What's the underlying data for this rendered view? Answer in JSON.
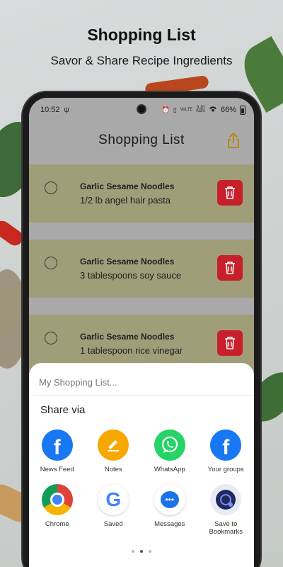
{
  "promo": {
    "title": "Shopping List",
    "subtitle": "Savor & Share Recipe Ingredients"
  },
  "status_bar": {
    "time": "10:52",
    "usb_icon": "usb-icon",
    "battery": "66%",
    "data_rate_top": "0.10",
    "data_rate_bottom": "KB/s",
    "signal_label": "VoLTE"
  },
  "app": {
    "title": "Shopping List",
    "share_icon": "share-icon"
  },
  "items": [
    {
      "recipe": "Garlic Sesame Noodles",
      "ingredient": "1/2 lb angel hair pasta"
    },
    {
      "recipe": "Garlic Sesame Noodles",
      "ingredient": "3 tablespoons soy sauce"
    },
    {
      "recipe": "Garlic Sesame Noodles",
      "ingredient": "1 tablespoon rice vinegar"
    }
  ],
  "share_sheet": {
    "subject": "My Shopping List...",
    "heading": "Share via",
    "apps": [
      {
        "label": "News Feed",
        "icon": "facebook-icon"
      },
      {
        "label": "Notes",
        "icon": "notes-icon"
      },
      {
        "label": "WhatsApp",
        "icon": "whatsapp-icon"
      },
      {
        "label": "Your groups",
        "icon": "facebook-icon"
      },
      {
        "label": "Chrome",
        "icon": "chrome-icon"
      },
      {
        "label": "Saved",
        "icon": "google-icon"
      },
      {
        "label": "Messages",
        "icon": "messages-icon"
      },
      {
        "label": "Save to Bookmarks",
        "icon": "bookmarks-icon"
      }
    ],
    "page_indicator": {
      "pages": 3,
      "current": 2
    }
  },
  "colors": {
    "item_bg": "#a09d79",
    "delete": "#c8202a",
    "share_icon": "#b8860b",
    "facebook": "#1877f2",
    "whatsapp": "#25d366",
    "notes": "#f6a800"
  }
}
